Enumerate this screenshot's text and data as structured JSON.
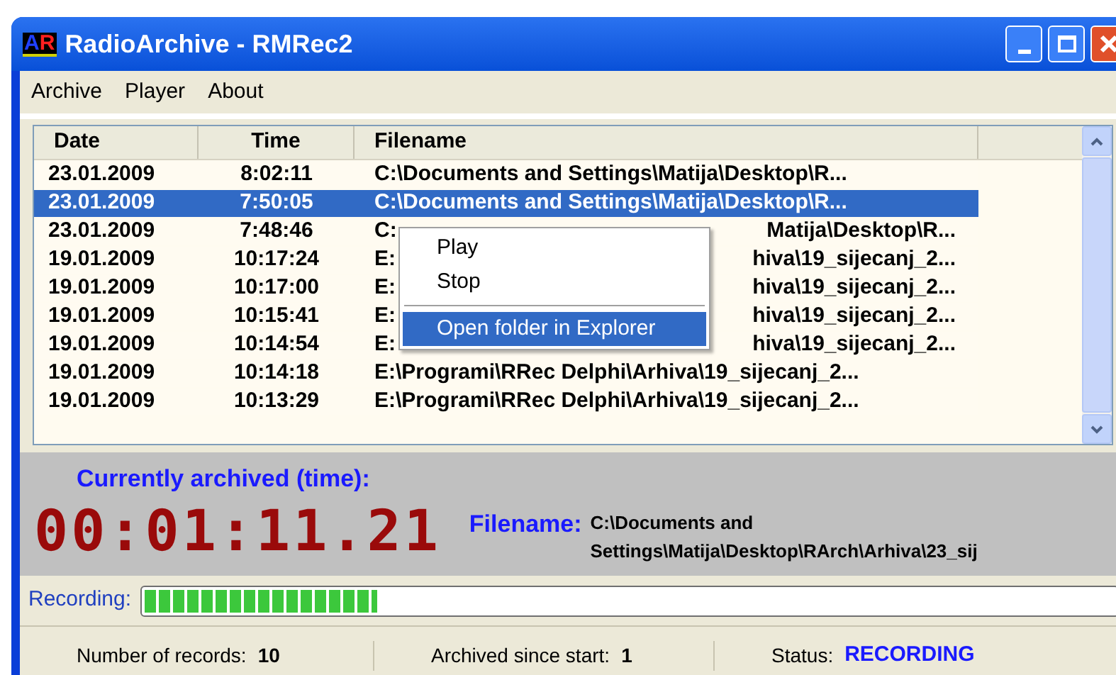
{
  "window": {
    "title": "RadioArchive - RMRec2",
    "icon_text": "AR"
  },
  "menu": [
    "Archive",
    "Player",
    "About"
  ],
  "table": {
    "columns": [
      "Date",
      "Time",
      "Filename"
    ],
    "rows": [
      {
        "date": "23.01.2009",
        "time": "8:02:11",
        "filename": [
          "C:\\Documents and Settings\\Matija\\Desktop\\R..."
        ],
        "selected": false
      },
      {
        "date": "23.01.2009",
        "time": "7:50:05",
        "filename": [
          "C:\\Documents and Settings\\Matija\\Desktop\\R..."
        ],
        "selected": true
      },
      {
        "date": "23.01.2009",
        "time": "7:48:46",
        "filename": [
          "C:",
          "Matija\\Desktop\\R..."
        ],
        "selected": false
      },
      {
        "date": "19.01.2009",
        "time": "10:17:24",
        "filename": [
          "E:",
          "hiva\\19_sijecanj_2..."
        ],
        "selected": false
      },
      {
        "date": "19.01.2009",
        "time": "10:17:00",
        "filename": [
          "E:",
          "hiva\\19_sijecanj_2..."
        ],
        "selected": false
      },
      {
        "date": "19.01.2009",
        "time": "10:15:41",
        "filename": [
          "E:",
          "hiva\\19_sijecanj_2..."
        ],
        "selected": false
      },
      {
        "date": "19.01.2009",
        "time": "10:14:54",
        "filename": [
          "E:",
          "hiva\\19_sijecanj_2..."
        ],
        "selected": false
      },
      {
        "date": "19.01.2009",
        "time": "10:14:18",
        "filename": [
          "E:\\Programi\\RRec Delphi\\Arhiva\\19_sijecanj_2..."
        ],
        "selected": false
      },
      {
        "date": "19.01.2009",
        "time": "10:13:29",
        "filename": [
          "E:\\Programi\\RRec Delphi\\Arhiva\\19_sijecanj_2..."
        ],
        "selected": false
      }
    ]
  },
  "context_menu": [
    {
      "kind": "item",
      "label": "Play",
      "selected": false
    },
    {
      "kind": "item",
      "label": "Stop",
      "selected": false
    },
    {
      "kind": "separator"
    },
    {
      "kind": "item",
      "label": "Open folder in Explorer",
      "selected": true
    }
  ],
  "archive_panel": {
    "heading": "Currently archived (time):",
    "timer": "00:01:11.21",
    "filename_label": "Filename:",
    "filename_lines": [
      "C:\\Documents and",
      "Settings\\Matija\\Desktop\\RArch\\Arhiva\\23_sij"
    ]
  },
  "recording": {
    "label": "Recording:",
    "level": 0.24
  },
  "status_bar": [
    {
      "label": "Number of records:",
      "value": "10",
      "kind": "plain"
    },
    {
      "label": "Archived since start:",
      "value": "1",
      "kind": "plain"
    },
    {
      "label": "Status:",
      "value": "RECORDING",
      "kind": "accent"
    }
  ]
}
